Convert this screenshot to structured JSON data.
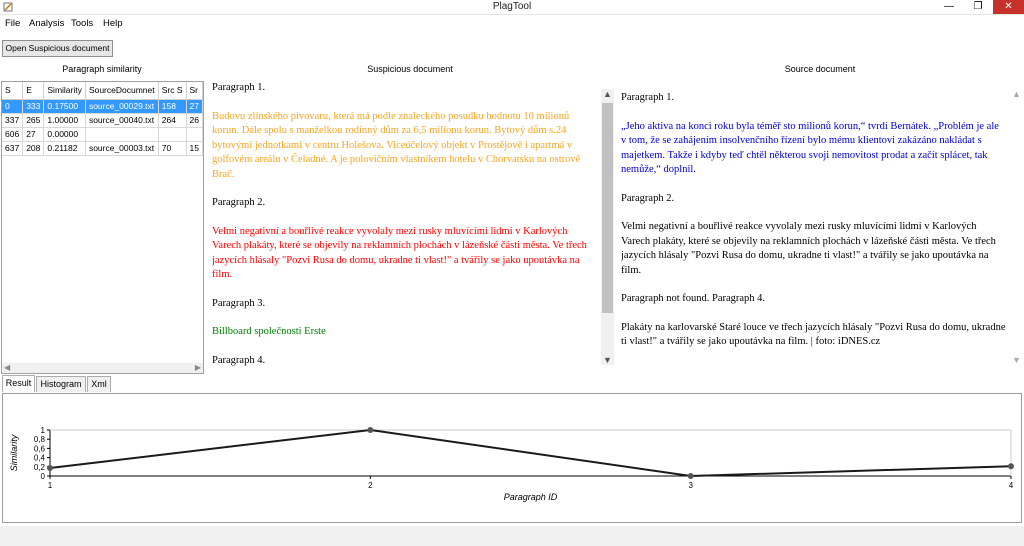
{
  "window": {
    "title": "PlagTool",
    "minimize": "—",
    "maximize": "❐",
    "close": "✕"
  },
  "menu": {
    "file": "File",
    "analysis": "Analysis",
    "tools": "Tools",
    "help": "Help"
  },
  "toolbar": {
    "open_button": "Open Suspicious document"
  },
  "labels": {
    "paragraph_similarity": "Paragraph similarity",
    "suspicious_document": "Suspicious document",
    "source_document": "Source document"
  },
  "grid": {
    "columns": [
      "S",
      "E",
      "Similarity",
      "SourceDocumnet",
      "Src S",
      "Sr"
    ],
    "rows": [
      [
        "0",
        "333",
        "0.17500",
        "source_00029.txt",
        "158",
        "27"
      ],
      [
        "337",
        "265",
        "1.00000",
        "source_00040.txt",
        "264",
        "26"
      ],
      [
        "606",
        "27",
        "0.00000",
        "",
        "",
        ""
      ],
      [
        "637",
        "208",
        "0.21182",
        "source_00003.txt",
        "70",
        "15"
      ]
    ]
  },
  "suspicious": {
    "p1_heading": "Paragraph 1.",
    "p1_text": "Budovu zlínského pivovaru, která má podle znaleckého posudku hodnotu 10 milionů korun. Dále spolu s manželkou rodinný dům za 6,5 milionu korun. Bytový dům s.24 bytovými jednotkami v centru Holešova. Viceúčelový objekt v Prostějově i apartmá v golfovém areálu v Čeladné. A je polovičním vlastníkem hotelu v Chorvatsku na ostrově Brač.",
    "p2_heading": "Paragraph 2.",
    "p2_text": "Velmi negativní a bouřlivé reakce vyvolaly mezi rusky mluvícími lidmi v Karlových Varech plakáty, které se objevily na reklamních plochách v lázeňské části města. Ve třech jazycích hlásaly \"Pozvi Rusa do domu, ukradne ti vlast!\" a tvářily se jako upoutávka na film.",
    "p3_heading": "Paragraph 3.",
    "p3_text": "Billboard společnosti Erste",
    "p4_heading": "Paragraph 4."
  },
  "source": {
    "p1_heading": "Paragraph 1.",
    "p1_text": "„Jeho aktiva na konci roku byla téměř sto milionů korun,“ tvrdí Bernátek. „Problém je ale v tom, že se zahájením insolvenčního řízení bylo mému klientovi zakázáno nakládat s majetkem. Takže i kdyby teď chtěl některou svoji nemovitost prodat a začít splácet, tak nemůže,“ doplnil.",
    "p2_heading": "Paragraph 2.",
    "p2_text": "Velmi negativní a bouřlivé reakce vyvolaly mezi rusky mluvícími lidmi v Karlových Varech plakáty, které se objevily na reklamních plochách v lázeňské části města. Ve třech jazycích hlásaly \"Pozvi Rusa do domu, ukradne ti vlast!\" a tvářily se jako upoutávka na film.",
    "p3_heading": "Paragraph not found. Paragraph 4.",
    "p4_text": "Plakáty na karlovarské Staré louce ve třech jazycích hlásaly \"Pozvi Rusa do domu, ukradne ti vlast!\" a tvářily se jako upoutávka na film. | foto: iDNES.cz"
  },
  "tabs": {
    "result": "Result",
    "histogram": "Histogram",
    "xml": "Xml"
  },
  "colors": {
    "orange_text": "#f5a623",
    "red_text": "#ff0000",
    "green_text": "#008000",
    "blue_text": "#0000d0",
    "selection": "#3399ff",
    "close_button": "#c7312b"
  },
  "chart_data": {
    "type": "line",
    "x": [
      1,
      2,
      3,
      4
    ],
    "values": [
      0.175,
      1.0,
      0.0,
      0.21182
    ],
    "xlabel": "Paragraph ID",
    "ylabel": "Similarity",
    "ylim": [
      0,
      1
    ],
    "yticks": [
      "0",
      "0,2",
      "0,4",
      "0,6",
      "0,8",
      "1"
    ],
    "xticks": [
      "1",
      "2",
      "3",
      "4"
    ],
    "grid": false
  }
}
